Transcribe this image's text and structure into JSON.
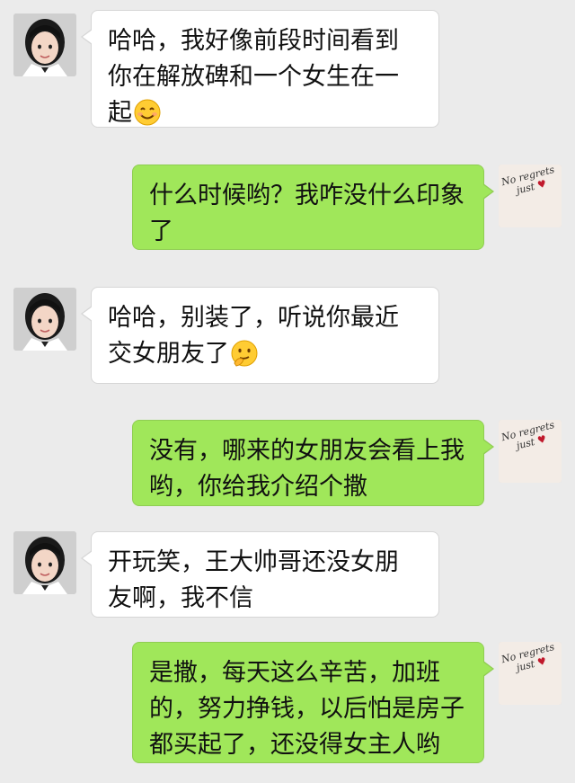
{
  "conversation": [
    {
      "side": "left",
      "avatar": "girl-avatar",
      "text": "哈哈，我好像前段时间看到你在解放碑和一个女生在一起",
      "emoji": "smile-emoji"
    },
    {
      "side": "right",
      "avatar": "no-regrets-avatar",
      "text": "什么时候哟？我咋没什么印象了"
    },
    {
      "side": "left",
      "avatar": "girl-avatar",
      "text": "哈哈，别装了，听说你最近交女朋友了",
      "emoji": "thinking-emoji"
    },
    {
      "side": "right",
      "avatar": "no-regrets-avatar",
      "text": "没有，哪来的女朋友会看上我哟，你给我介绍个撒"
    },
    {
      "side": "left",
      "avatar": "girl-avatar",
      "text": "开玩笑，王大帅哥还没女朋友啊，我不信"
    },
    {
      "side": "right",
      "avatar": "no-regrets-avatar",
      "text": "是撒，每天这么辛苦，加班的，努力挣钱，以后怕是房子都买起了，还没得女主人哟"
    }
  ],
  "self_avatar_text": [
    "No regrets",
    "just"
  ],
  "colors": {
    "background": "#ebebeb",
    "incoming_bubble": "#ffffff",
    "outgoing_bubble": "#a0e75a"
  }
}
